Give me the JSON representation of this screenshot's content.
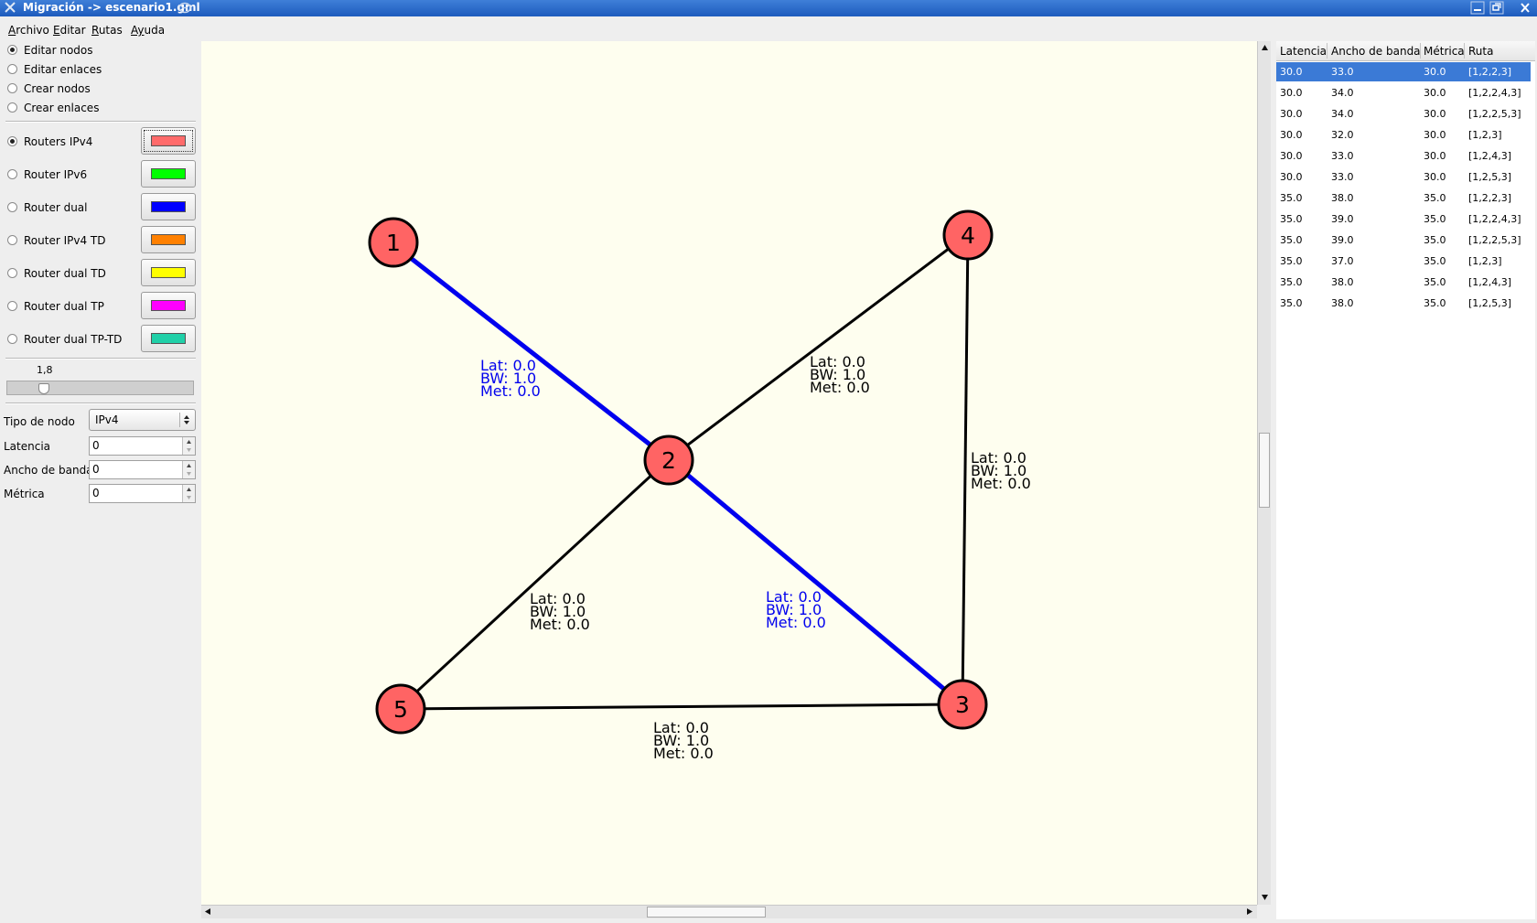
{
  "window": {
    "title": "Migración -> escenario1.gml"
  },
  "menu": [
    {
      "mnemonic": "A",
      "rest": "rchivo"
    },
    {
      "mnemonic": "E",
      "rest": "ditar"
    },
    {
      "mnemonic": "R",
      "rest": "utas"
    },
    {
      "mnemonic": "Ay",
      "rest": "uda",
      "underline_index": 1
    }
  ],
  "modes": [
    {
      "label": "Editar nodos",
      "checked": true
    },
    {
      "label": "Editar enlaces",
      "checked": false
    },
    {
      "label": "Crear nodos",
      "checked": false
    },
    {
      "label": "Crear enlaces",
      "checked": false
    }
  ],
  "router_types": [
    {
      "label": "Routers IPv4",
      "color": "#ff6b6b",
      "checked": true
    },
    {
      "label": "Router IPv6",
      "color": "#00ff00",
      "checked": false
    },
    {
      "label": "Router dual",
      "color": "#0000ff",
      "checked": false
    },
    {
      "label": "Router IPv4 TD",
      "color": "#ff8000",
      "checked": false
    },
    {
      "label": "Router dual TD",
      "color": "#ffff00",
      "checked": false
    },
    {
      "label": "Router dual TP",
      "color": "#ff00ff",
      "checked": false
    },
    {
      "label": "Router dual TP-TD",
      "color": "#20d0a8",
      "checked": false
    }
  ],
  "zoom": {
    "label": "1,8",
    "value": 1.8
  },
  "properties": {
    "node_type": {
      "label": "Tipo de nodo",
      "value": "IPv4"
    },
    "latency": {
      "label": "Latencia",
      "value": "0"
    },
    "bandwidth": {
      "label": "Ancho de banda",
      "value": "0"
    },
    "metric": {
      "label": "Métrica",
      "value": "0"
    }
  },
  "graph": {
    "node_color": "#ff6464",
    "highlight_color": "#0000ee",
    "nodes": [
      {
        "id": "1",
        "label": "1"
      },
      {
        "id": "2",
        "label": "2"
      },
      {
        "id": "3",
        "label": "3"
      },
      {
        "id": "4",
        "label": "4"
      },
      {
        "id": "5",
        "label": "5"
      }
    ],
    "edges": [
      {
        "from": "1",
        "to": "2",
        "highlighted": true,
        "lat": "Lat: 0.0",
        "bw": "BW: 1.0",
        "met": "Met: 0.0"
      },
      {
        "from": "2",
        "to": "4",
        "highlighted": false,
        "lat": "Lat: 0.0",
        "bw": "BW: 1.0",
        "met": "Met: 0.0"
      },
      {
        "from": "4",
        "to": "3",
        "highlighted": false,
        "lat": "Lat: 0.0",
        "bw": "BW: 1.0",
        "met": "Met: 0.0"
      },
      {
        "from": "2",
        "to": "5",
        "highlighted": false,
        "lat": "Lat: 0.0",
        "bw": "BW: 1.0",
        "met": "Met: 0.0"
      },
      {
        "from": "2",
        "to": "3",
        "highlighted": true,
        "lat": "Lat: 0.0",
        "bw": "BW: 1.0",
        "met": "Met: 0.0"
      },
      {
        "from": "5",
        "to": "3",
        "highlighted": false,
        "lat": "Lat: 0.0",
        "bw": "BW: 1.0",
        "met": "Met: 0.0"
      }
    ]
  },
  "routes": {
    "columns": [
      "Latencia",
      "Ancho de banda",
      "Métrica",
      "Ruta"
    ],
    "rows": [
      {
        "latencia": "30.0",
        "ancho": "33.0",
        "metrica": "30.0",
        "ruta": "[1,2,2,3]",
        "selected": true
      },
      {
        "latencia": "30.0",
        "ancho": "34.0",
        "metrica": "30.0",
        "ruta": "[1,2,2,4,3]",
        "selected": false
      },
      {
        "latencia": "30.0",
        "ancho": "34.0",
        "metrica": "30.0",
        "ruta": "[1,2,2,5,3]",
        "selected": false
      },
      {
        "latencia": "30.0",
        "ancho": "32.0",
        "metrica": "30.0",
        "ruta": "[1,2,3]",
        "selected": false
      },
      {
        "latencia": "30.0",
        "ancho": "33.0",
        "metrica": "30.0",
        "ruta": "[1,2,4,3]",
        "selected": false
      },
      {
        "latencia": "30.0",
        "ancho": "33.0",
        "metrica": "30.0",
        "ruta": "[1,2,5,3]",
        "selected": false
      },
      {
        "latencia": "35.0",
        "ancho": "38.0",
        "metrica": "35.0",
        "ruta": "[1,2,2,3]",
        "selected": false
      },
      {
        "latencia": "35.0",
        "ancho": "39.0",
        "metrica": "35.0",
        "ruta": "[1,2,2,4,3]",
        "selected": false
      },
      {
        "latencia": "35.0",
        "ancho": "39.0",
        "metrica": "35.0",
        "ruta": "[1,2,2,5,3]",
        "selected": false
      },
      {
        "latencia": "35.0",
        "ancho": "37.0",
        "metrica": "35.0",
        "ruta": "[1,2,3]",
        "selected": false
      },
      {
        "latencia": "35.0",
        "ancho": "38.0",
        "metrica": "35.0",
        "ruta": "[1,2,4,3]",
        "selected": false
      },
      {
        "latencia": "35.0",
        "ancho": "38.0",
        "metrica": "35.0",
        "ruta": "[1,2,5,3]",
        "selected": false
      }
    ]
  }
}
